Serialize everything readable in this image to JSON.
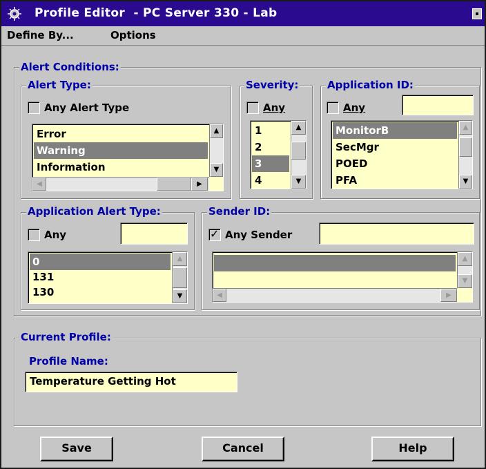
{
  "window": {
    "title": "Profile Editor  - PC Server 330 - Lab"
  },
  "menubar": {
    "define_by": "Define By...",
    "options": "Options"
  },
  "alert_conditions": {
    "label": "Alert Conditions:",
    "alert_type": {
      "label": "Alert Type:",
      "any_label": "Any Alert Type",
      "any_checked": false,
      "items": [
        "Error",
        "Warning",
        "Information"
      ],
      "selected": "Warning"
    },
    "severity": {
      "label": "Severity:",
      "any_label": "Any",
      "any_checked": false,
      "items": [
        "1",
        "2",
        "3",
        "4"
      ],
      "selected": "3"
    },
    "application_id": {
      "label": "Application ID:",
      "any_label": "Any",
      "any_checked": false,
      "value": "",
      "items": [
        "MonitorB",
        "SecMgr",
        "POED",
        "PFA"
      ],
      "selected": "MonitorB"
    },
    "application_alert_type": {
      "label": "Application Alert Type:",
      "any_label": "Any",
      "any_checked": false,
      "value": "",
      "items": [
        "0",
        "131",
        "130"
      ],
      "selected": "0"
    },
    "sender_id": {
      "label": "Sender ID:",
      "any_label": "Any Sender",
      "any_checked": true,
      "value": "",
      "items": [
        ""
      ],
      "selected": ""
    }
  },
  "current_profile": {
    "label": "Current Profile:",
    "profile_name_label": "Profile Name:",
    "profile_name": "Temperature Getting Hot"
  },
  "buttons": {
    "save": "Save",
    "cancel": "Cancel",
    "help": "Help"
  },
  "colors": {
    "titlebar": "#2a0a8e",
    "group_label": "#0000a8",
    "field_bg": "#ffffc8",
    "selection": "#808080"
  }
}
